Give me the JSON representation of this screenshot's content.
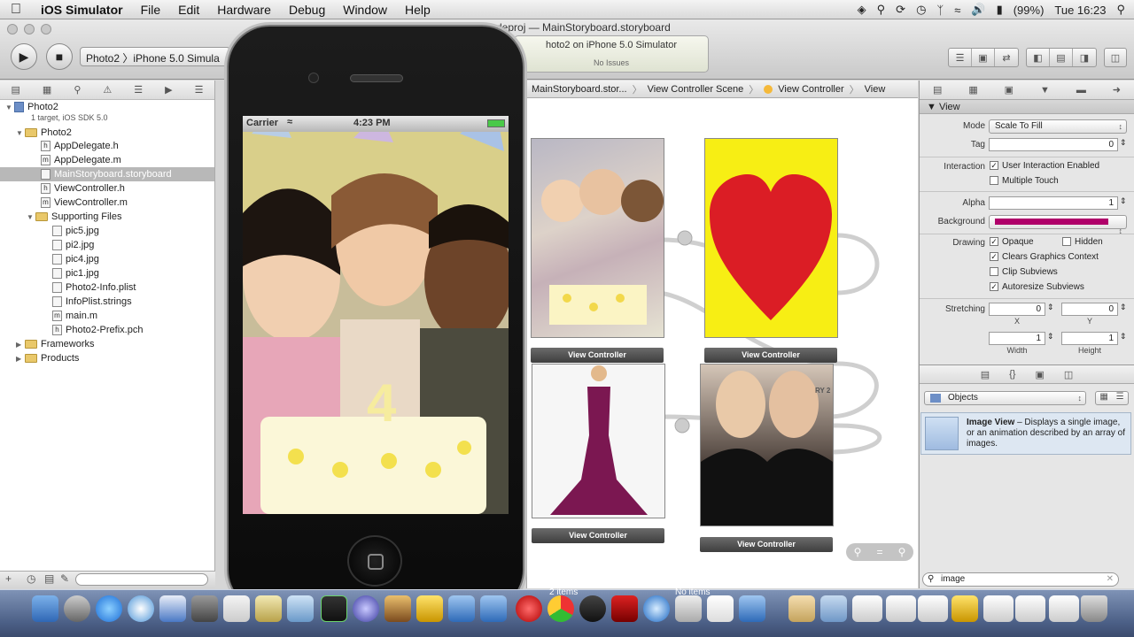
{
  "menubar": {
    "apple": "",
    "app_name": "iOS Simulator",
    "items": [
      "File",
      "Edit",
      "Hardware",
      "Debug",
      "Window",
      "Help"
    ],
    "battery": "(99%)",
    "clock": "Tue 16:23"
  },
  "toolbar": {
    "scheme": "Photo2 〉iPhone 5.0 Simula",
    "window_title": "deproj — MainStoryboard.storyboard",
    "activity_title": "hoto2 on iPhone 5.0 Simulator",
    "activity_status": "No Issues"
  },
  "navigator": {
    "project": {
      "name": "Photo2",
      "subtitle": "1 target, iOS SDK 5.0"
    },
    "rows": [
      {
        "label": "Photo2",
        "type": "folder"
      },
      {
        "label": "AppDelegate.h",
        "type": "h"
      },
      {
        "label": "AppDelegate.m",
        "type": "m"
      },
      {
        "label": "MainStoryboard.storyboard",
        "type": "sb"
      },
      {
        "label": "ViewController.h",
        "type": "h"
      },
      {
        "label": "ViewController.m",
        "type": "m"
      },
      {
        "label": "Supporting Files",
        "type": "folder"
      },
      {
        "label": "pic5.jpg",
        "type": "img"
      },
      {
        "label": "pi2.jpg",
        "type": "img"
      },
      {
        "label": "pic4.jpg",
        "type": "img"
      },
      {
        "label": "pic1.jpg",
        "type": "img"
      },
      {
        "label": "Photo2-Info.plist",
        "type": "file"
      },
      {
        "label": "InfoPlist.strings",
        "type": "file"
      },
      {
        "label": "main.m",
        "type": "m"
      },
      {
        "label": "Photo2-Prefix.pch",
        "type": "h"
      },
      {
        "label": "Frameworks",
        "type": "folder"
      },
      {
        "label": "Products",
        "type": "folder"
      }
    ]
  },
  "jumpbar": [
    "MainStoryboard.stor...",
    "View Controller Scene",
    "View Controller",
    "View"
  ],
  "storyboard": {
    "vc_label": "View Controller",
    "vc_label_note": "RY 2"
  },
  "simulator": {
    "carrier": "Carrier",
    "time": "4:23 PM"
  },
  "inspector": {
    "section_view": "View",
    "mode_label": "Mode",
    "mode_value": "Scale To Fill",
    "tag_label": "Tag",
    "tag_value": "0",
    "interaction_label": "Interaction",
    "user_interaction": "User Interaction Enabled",
    "multiple_touch": "Multiple Touch",
    "alpha_label": "Alpha",
    "alpha_value": "1",
    "background_label": "Background",
    "background_color": "#b0006a",
    "drawing_label": "Drawing",
    "opaque": "Opaque",
    "hidden": "Hidden",
    "clears": "Clears Graphics Context",
    "clip": "Clip Subviews",
    "autoresize": "Autoresize Subviews",
    "stretching_label": "Stretching",
    "stretch_x": "0",
    "stretch_y": "0",
    "x_label": "X",
    "y_label": "Y",
    "stretch_w": "1",
    "stretch_h": "1",
    "width_label": "Width",
    "height_label": "Height",
    "library_popup": "Objects",
    "lib_item_title": "Image View",
    "lib_item_desc": " – Displays a single image, or an animation described by an array of images.",
    "search_value": "image"
  },
  "dock": {
    "label_2items": "2 items",
    "label_noitems": "No items"
  }
}
